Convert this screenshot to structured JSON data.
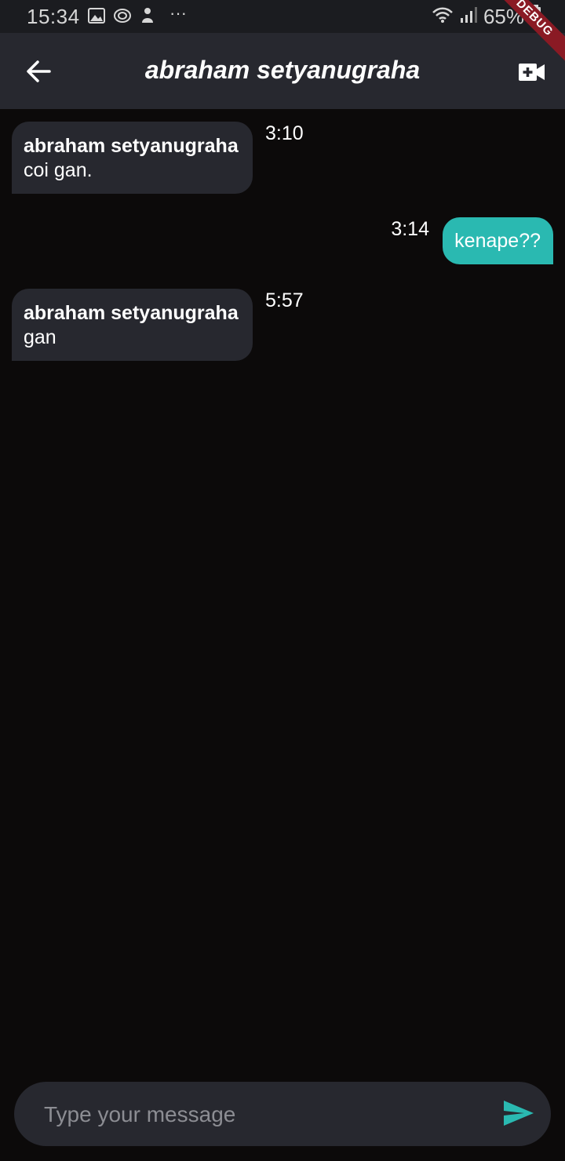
{
  "status_bar": {
    "time": "15:34",
    "more": "···",
    "battery": "65%"
  },
  "debug_banner": "DEBUG",
  "app_bar": {
    "title": "abraham setyanugraha",
    "back_icon": "arrow-left-icon",
    "action_icon": "video-call-icon"
  },
  "messages": [
    {
      "direction": "incoming",
      "sender": "abraham setyanugraha",
      "text": "coi gan.",
      "time": "3:10"
    },
    {
      "direction": "outgoing",
      "text": "kenape??",
      "time": "3:14"
    },
    {
      "direction": "incoming",
      "sender": "abraham setyanugraha",
      "text": "gan",
      "time": "5:57"
    }
  ],
  "composer": {
    "placeholder": "Type your message",
    "value": "",
    "send_icon": "send-icon"
  },
  "colors": {
    "background": "#0c0a0a",
    "app_bar": "#27282f",
    "incoming_bubble": "#27282f",
    "outgoing_bubble": "#2ab9b1",
    "send_icon": "#2ab9b1",
    "debug_ribbon": "#8a1a24"
  }
}
